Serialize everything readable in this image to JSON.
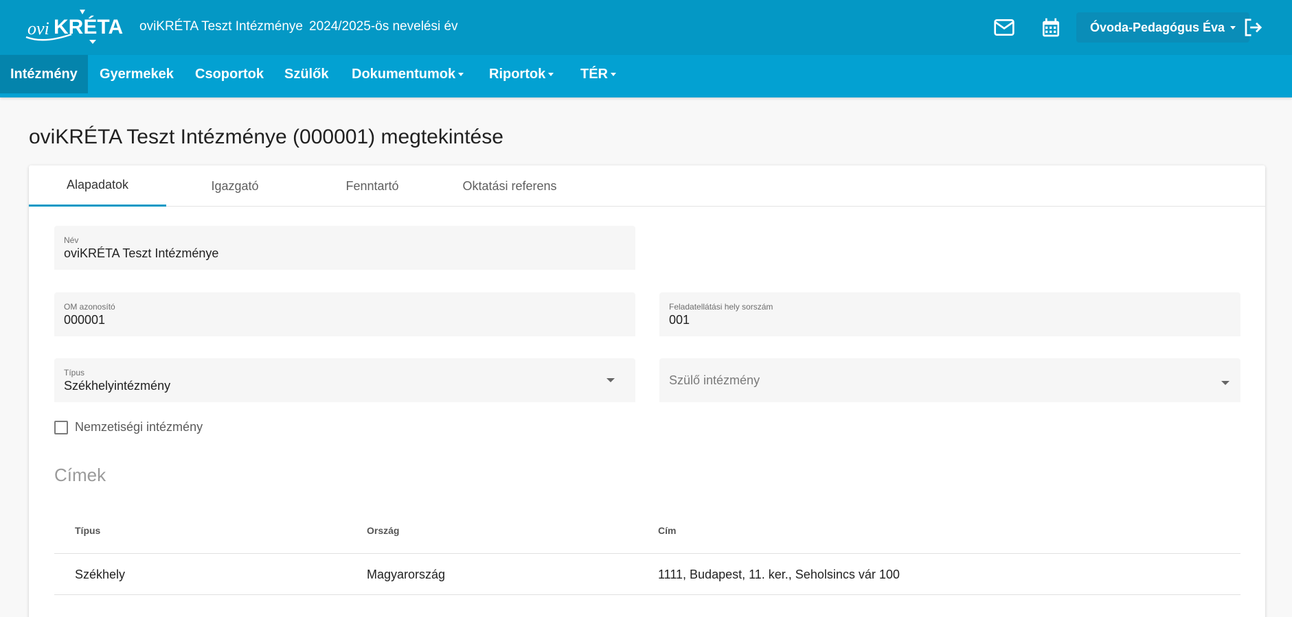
{
  "app": {
    "logo_text": "oviKRÉTA",
    "institution_name": "oviKRÉTA Teszt Intézménye",
    "school_year": "2024/2025-ös nevelési év",
    "user_name": "Óvoda-Pedagógus Éva",
    "icons": {
      "mail": "mail-icon",
      "calendar": "calendar-icon",
      "logout": "logout-icon"
    }
  },
  "nav": {
    "items": [
      {
        "label": "Intézmény",
        "active": true,
        "dropdown": false
      },
      {
        "label": "Gyermekek",
        "active": false,
        "dropdown": false
      },
      {
        "label": "Csoportok",
        "active": false,
        "dropdown": false
      },
      {
        "label": "Szülők",
        "active": false,
        "dropdown": false
      },
      {
        "label": "Dokumentumok",
        "active": false,
        "dropdown": true
      },
      {
        "label": "Riportok",
        "active": false,
        "dropdown": true
      },
      {
        "label": "TÉR",
        "active": false,
        "dropdown": true
      }
    ]
  },
  "page": {
    "title": "oviKRÉTA Teszt Intézménye (000001) megtekintése"
  },
  "tabs": [
    {
      "label": "Alapadatok",
      "active": true
    },
    {
      "label": "Igazgató",
      "active": false
    },
    {
      "label": "Fenntartó",
      "active": false
    },
    {
      "label": "Oktatási referens",
      "active": false
    }
  ],
  "form": {
    "name": {
      "label": "Név",
      "value": "oviKRÉTA Teszt Intézménye"
    },
    "om_id": {
      "label": "OM azonosító",
      "value": "000001"
    },
    "site_number": {
      "label": "Feladatellátási hely sorszám",
      "value": "001"
    },
    "type": {
      "label": "Típus",
      "value": "Székhelyintézmény"
    },
    "parent_institution": {
      "placeholder": "Szülő intézmény"
    },
    "nationality": {
      "label": "Nemzetiségi intézmény",
      "checked": false
    }
  },
  "addresses": {
    "title": "Címek",
    "columns": [
      "Típus",
      "Ország",
      "Cím"
    ],
    "rows": [
      [
        "Székhely",
        "Magyarország",
        "1111, Budapest, 11. ker., Seholsincs vár 100"
      ]
    ]
  },
  "colors": {
    "header": "#0498c5",
    "nav": "#03a1d2",
    "nav_active": "#0484ac",
    "accent": "#0498c5"
  }
}
